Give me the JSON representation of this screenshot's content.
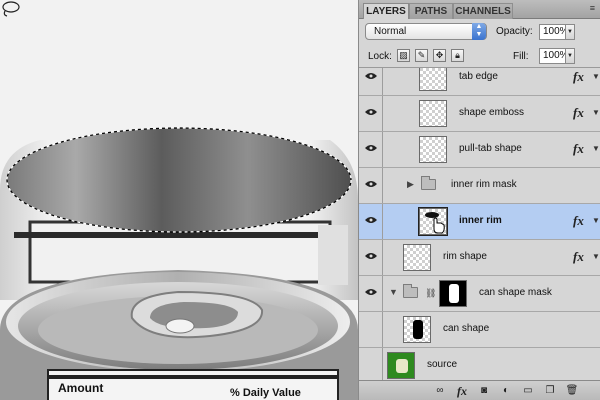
{
  "tabs": [
    {
      "label": "LAYERS",
      "active": true
    },
    {
      "label": "PATHS",
      "active": false
    },
    {
      "label": "CHANNELS",
      "active": false
    }
  ],
  "options": {
    "blend_mode": "Normal",
    "opacity_label": "Opacity:",
    "opacity_value": "100%",
    "lock_label": "Lock:",
    "fill_label": "Fill:",
    "fill_value": "100%"
  },
  "layers": [
    {
      "name": "tab edge",
      "visible": true,
      "fx": true,
      "type": "layer"
    },
    {
      "name": "shape emboss",
      "visible": true,
      "fx": true,
      "type": "layer"
    },
    {
      "name": "pull-tab shape",
      "visible": true,
      "fx": true,
      "type": "layer"
    },
    {
      "name": "inner rim mask",
      "visible": true,
      "fx": false,
      "type": "group"
    },
    {
      "name": "inner rim",
      "visible": true,
      "fx": true,
      "type": "layer",
      "selected": true
    },
    {
      "name": "rim shape",
      "visible": true,
      "fx": true,
      "type": "layer"
    },
    {
      "name": "can shape mask",
      "visible": true,
      "fx": false,
      "type": "masked-group"
    },
    {
      "name": "can shape",
      "visible": false,
      "fx": false,
      "type": "layer"
    },
    {
      "name": "source",
      "visible": false,
      "fx": false,
      "type": "image-layer"
    }
  ],
  "fx_label": "fx",
  "canvas": {
    "label_lines": [
      "Amount",
      "% Daily Value"
    ]
  },
  "footer_icons": [
    "link-icon",
    "fx-icon",
    "mask-icon",
    "adjustment-icon",
    "new-group-icon",
    "new-layer-icon",
    "trash-icon"
  ]
}
